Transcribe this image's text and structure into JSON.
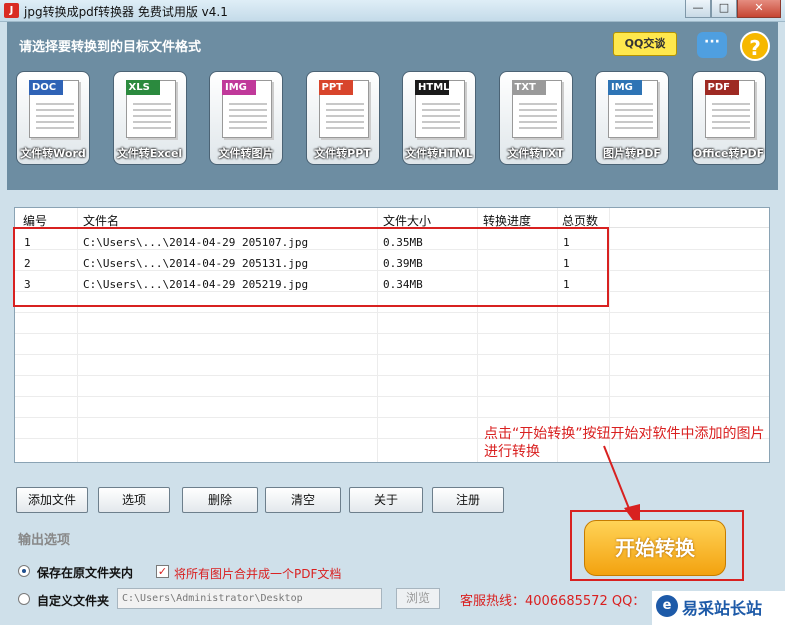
{
  "window": {
    "title": "jpg转换成pdf转换器 免费试用版 v4.1",
    "controls": {
      "minimize": "—",
      "maximize": "□",
      "close": "✕"
    }
  },
  "header": {
    "title": "请选择要转换到的目标文件格式",
    "qq_label": "QQ交谈",
    "help_symbol": "?",
    "chat_symbol": "···",
    "tools": [
      {
        "tag": "DOC",
        "label": "文件转Word",
        "color": "#2f63b6"
      },
      {
        "tag": "XLS",
        "label": "文件转Excel",
        "color": "#2b8a3e"
      },
      {
        "tag": "IMG",
        "label": "文件转图片",
        "color": "#c0399a"
      },
      {
        "tag": "PPT",
        "label": "文件转PPT",
        "color": "#d8452c"
      },
      {
        "tag": "HTML",
        "label": "文件转HTML",
        "color": "#1a1a1a"
      },
      {
        "tag": "TXT",
        "label": "文件转TXT",
        "color": "#9a9a9a"
      },
      {
        "tag": "IMG",
        "label": "图片转PDF",
        "color": "#2e74b5"
      },
      {
        "tag": "PDF",
        "label": "Office转PDF",
        "color": "#9e2a23"
      }
    ]
  },
  "table": {
    "columns": [
      "编号",
      "文件名",
      "文件大小",
      "转换进度",
      "总页数"
    ],
    "rows": [
      {
        "id": "1",
        "filename": "C:\\Users\\...\\2014-04-29 205107.jpg",
        "size": "0.35MB",
        "progress": "",
        "pages": "1"
      },
      {
        "id": "2",
        "filename": "C:\\Users\\...\\2014-04-29 205131.jpg",
        "size": "0.39MB",
        "progress": "",
        "pages": "1"
      },
      {
        "id": "3",
        "filename": "C:\\Users\\...\\2014-04-29 205219.jpg",
        "size": "0.34MB",
        "progress": "",
        "pages": "1"
      }
    ]
  },
  "annotation": "点击“开始转换”按钮开始对软件中添加的图片进行转换",
  "buttons": {
    "add_file": "添加文件",
    "options": "选项",
    "delete": "删除",
    "clear": "清空",
    "about": "关于",
    "register": "注册"
  },
  "output": {
    "title": "输出选项",
    "save_original": "保存在原文件夹内",
    "merge_pdf": "将所有图片合并成一个PDF文档",
    "custom_folder": "自定义文件夹",
    "path_value": "C:\\Users\\Administrator\\Desktop",
    "browse": "浏览"
  },
  "hotline": "客服热线：4006685572 QQ：",
  "start_button": "开始转换",
  "watermark": {
    "icon": "e",
    "text": "易采站长站"
  }
}
